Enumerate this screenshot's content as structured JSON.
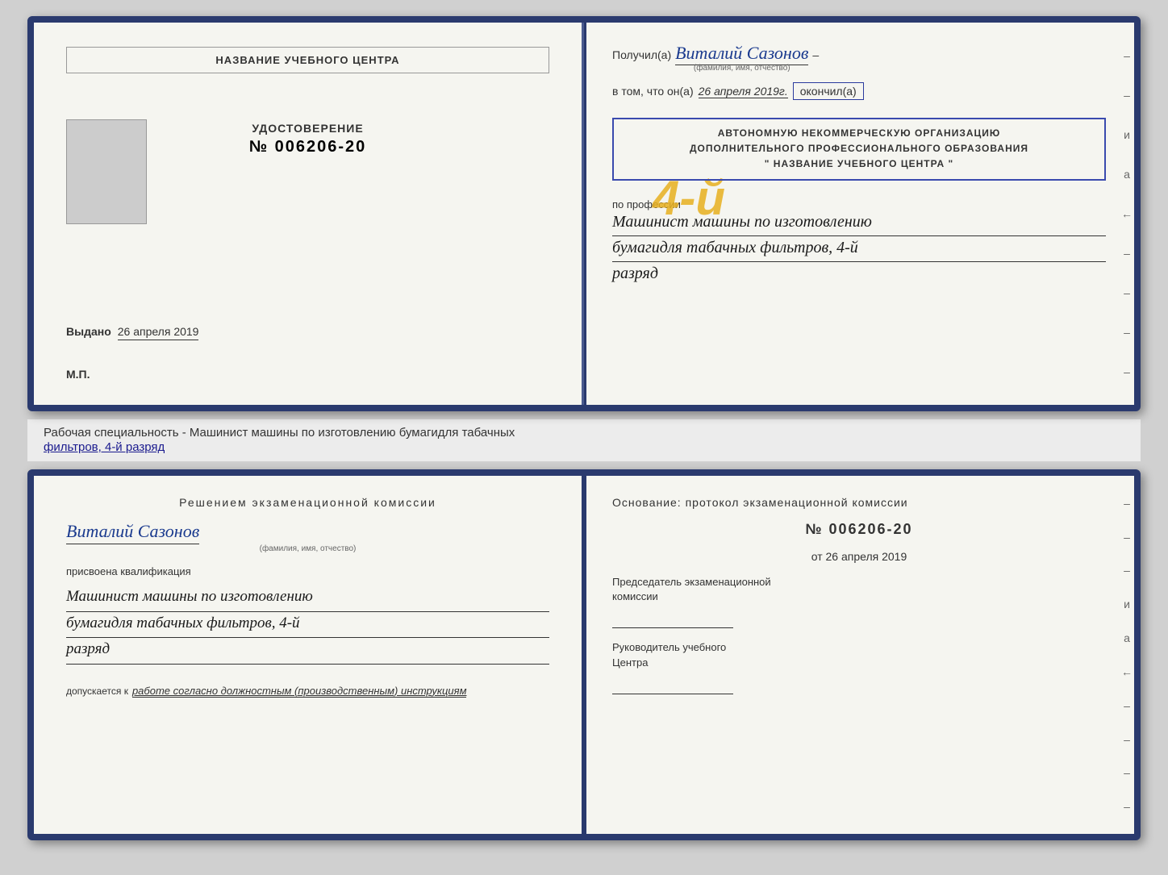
{
  "top": {
    "left": {
      "training_center_label": "НАЗВАНИЕ УЧЕБНОГО ЦЕНТРА",
      "udostoverenie_title": "УДОСТОВЕРЕНИЕ",
      "cert_number": "№ 006206-20",
      "vydano_label": "Выдано",
      "vydano_date": "26 апреля 2019",
      "mp_label": "М.П."
    },
    "right": {
      "recipient_prefix": "Получил(а)",
      "recipient_name": "Виталий Сазонов",
      "recipient_subtitle": "(фамилия, имя, отчество)",
      "vtom_prefix": "в том, что он(а)",
      "vtom_date": "26 апреля 2019г.",
      "vtom_okончил": "окончил(а)",
      "big_number": "4-й",
      "org_line1": "АВТОНОМНУЮ НЕКОММЕРЧЕСКУЮ ОРГАНИЗАЦИЮ",
      "org_line2": "ДОПОЛНИТЕЛЬНОГО ПРОФЕССИОНАЛЬНОГО ОБРАЗОВАНИЯ",
      "org_line3": "\" НАЗВАНИЕ УЧЕБНОГО ЦЕНТРА \"",
      "profession_label": "по профессии",
      "profession_line1": "Машинист машины по изготовлению",
      "profession_line2": "бумагидля табачных фильтров, 4-й",
      "profession_line3": "разряд"
    }
  },
  "specialty_strip": {
    "text_normal": "Рабочая специальность - Машинист машины по изготовлению бумагидля табачных",
    "text_underline": "фильтров, 4-й разряд"
  },
  "bottom": {
    "left": {
      "commission_title": "Решением  экзаменационной  комиссии",
      "person_name": "Виталий Сазонов",
      "fio_subtitle": "(фамилия, имя, отчество)",
      "assigned_label": "присвоена квалификация",
      "qualification_line1": "Машинист машины по изготовлению",
      "qualification_line2": "бумагидля табачных фильтров, 4-й",
      "qualification_line3": "разряд",
      "допускается_label": "допускается к",
      "допускается_value": "работе согласно должностным (производственным) инструкциям"
    },
    "right": {
      "osnование": "Основание: протокол экзаменационной  комиссии",
      "protocol_number": "№  006206-20",
      "protocol_date_prefix": "от",
      "protocol_date": "26 апреля 2019",
      "chairman_label_line1": "Председатель экзаменационной",
      "chairman_label_line2": "комиссии",
      "head_label_line1": "Руководитель учебного",
      "head_label_line2": "Центра"
    }
  },
  "side_decorations": [
    "–",
    "а",
    "←",
    "–",
    "–",
    "–",
    "–",
    "–"
  ],
  "bottom_side_decorations": [
    "–",
    "–",
    "–",
    "и",
    "а",
    "←",
    "–",
    "–",
    "–",
    "–"
  ]
}
